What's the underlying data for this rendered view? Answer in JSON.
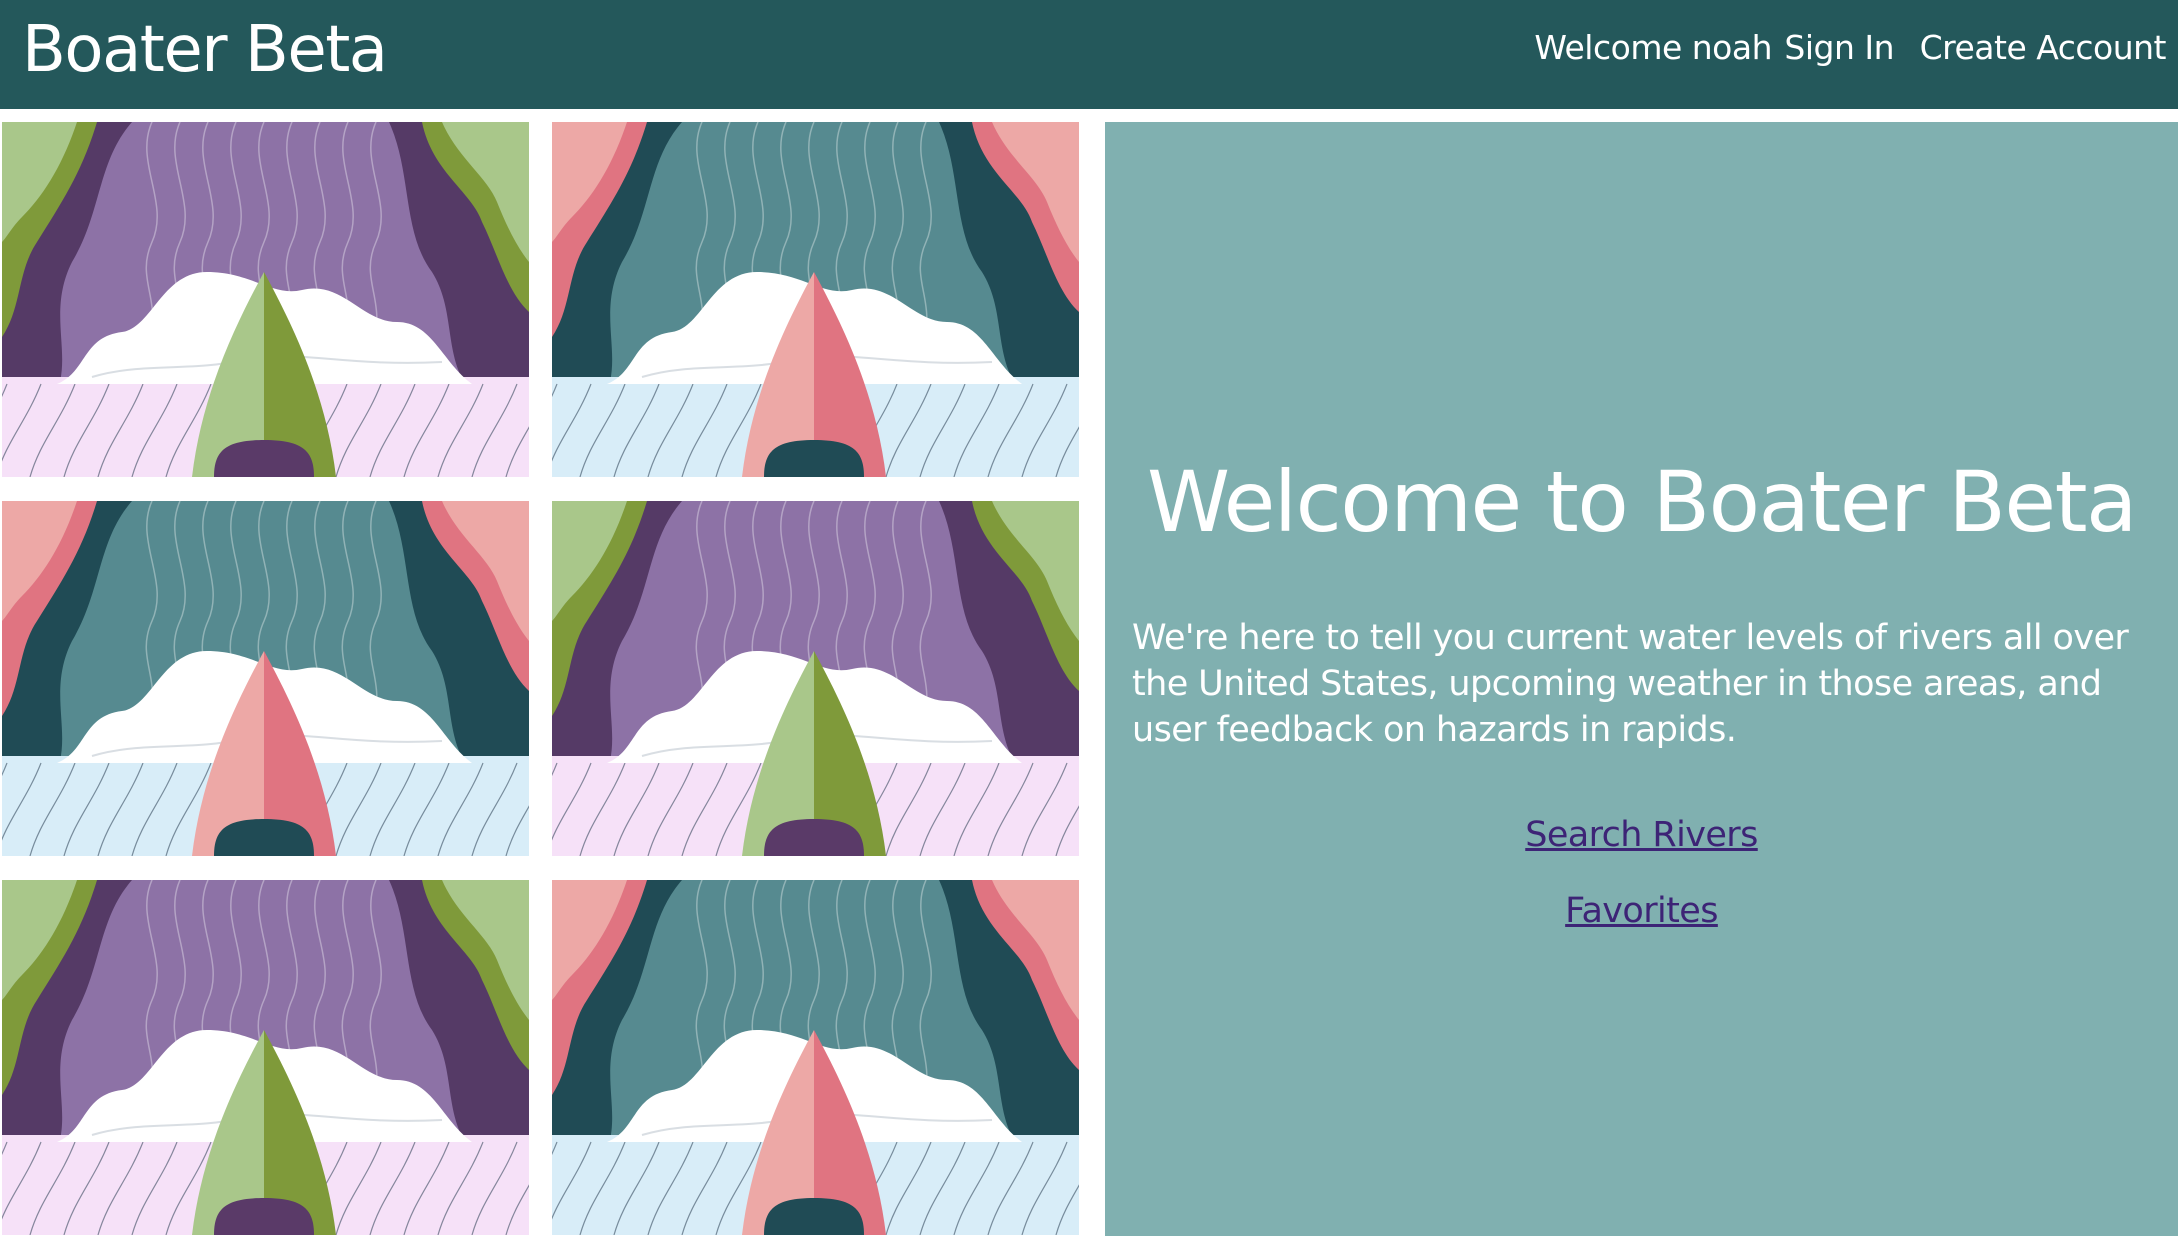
{
  "header": {
    "brand": "Boater Beta",
    "welcome": "Welcome noah",
    "sign_in": "Sign In",
    "create_account": "Create Account"
  },
  "hero": {
    "title": "Welcome to Boater Beta",
    "description": "We're here to tell you current water levels of rivers all over the United States, upcoming weather in those areas, and user feedback on hazards in rapids.",
    "links": {
      "search_rivers": "Search Rivers",
      "favorites": "Favorites"
    }
  },
  "colors": {
    "navbar": "#24585b",
    "hero_background": "#80b0b0",
    "link": "#3d2476",
    "purple_theme": [
      "#a9c78a",
      "#7f9a3a",
      "#553a66",
      "#8d72a6",
      "#f6e1f8",
      "#5a3a68"
    ],
    "teal_theme": [
      "#eda8a6",
      "#e07481",
      "#204b55",
      "#568a90",
      "#d8edf8",
      "#204b55"
    ]
  },
  "tiles": [
    {
      "theme": "purple"
    },
    {
      "theme": "teal"
    },
    {
      "theme": "teal"
    },
    {
      "theme": "purple"
    },
    {
      "theme": "purple"
    },
    {
      "theme": "teal"
    }
  ]
}
